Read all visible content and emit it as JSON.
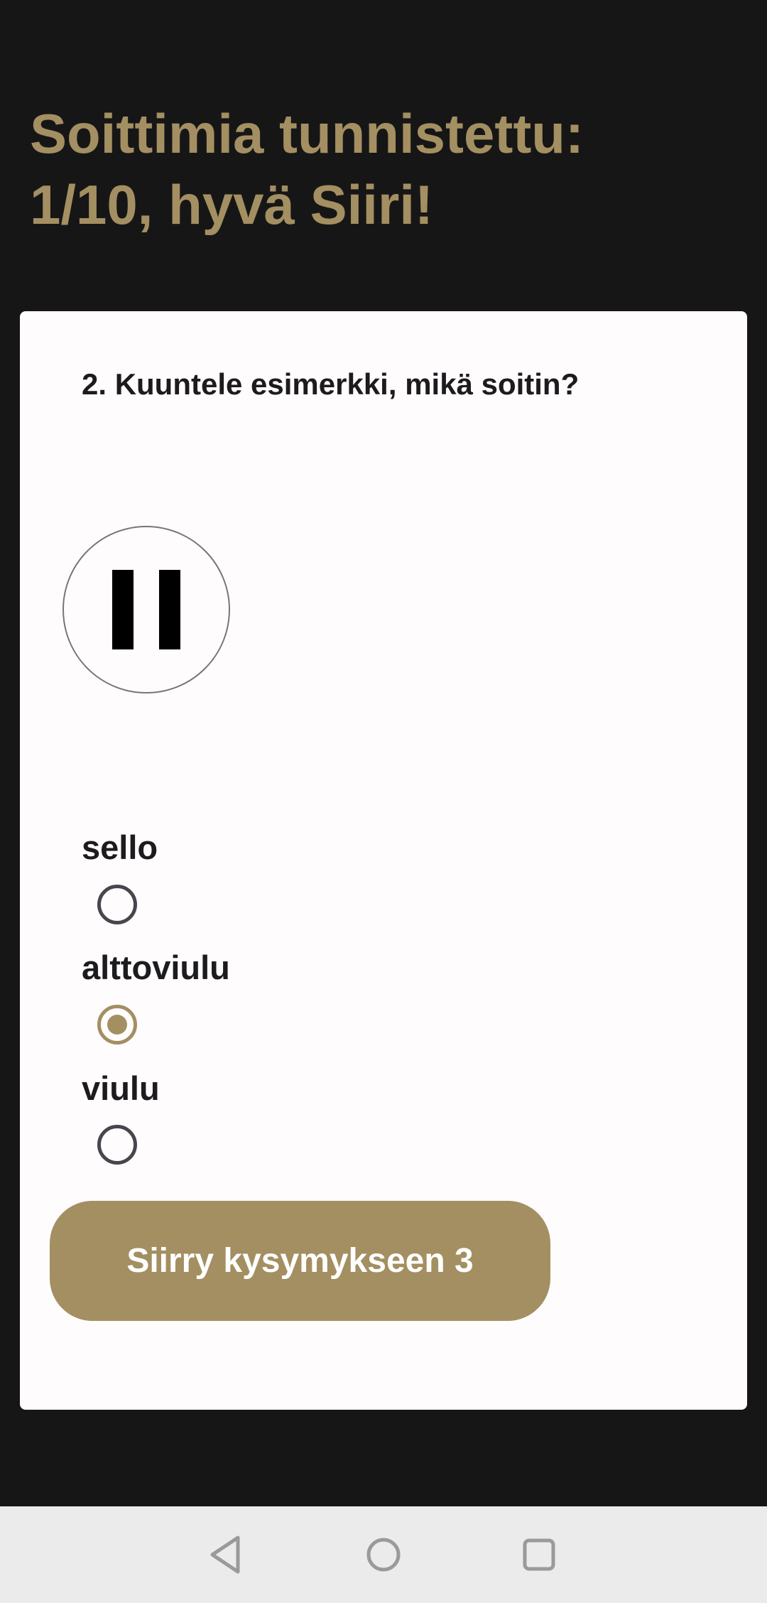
{
  "header": {
    "title": "Soittimia tunnistettu:\n1/10, hyvä Siiri!"
  },
  "quiz": {
    "question": "2. Kuuntele esimerkki, mikä soitin?",
    "player": {
      "state": "playing",
      "icon": "pause-icon"
    },
    "options": [
      {
        "label": "sello",
        "selected": false
      },
      {
        "label": "alttoviulu",
        "selected": true
      },
      {
        "label": "viulu",
        "selected": false
      }
    ],
    "next_button_label": "Siirry kysymykseen 3"
  },
  "nav_bar": {
    "buttons": [
      "back-icon",
      "home-icon",
      "recents-icon"
    ]
  },
  "colors": {
    "accent": "#a38f61",
    "background": "#171617",
    "card": "#fffcfe",
    "text": "#1c1b1e",
    "nav_bar": "#ebebeb"
  }
}
